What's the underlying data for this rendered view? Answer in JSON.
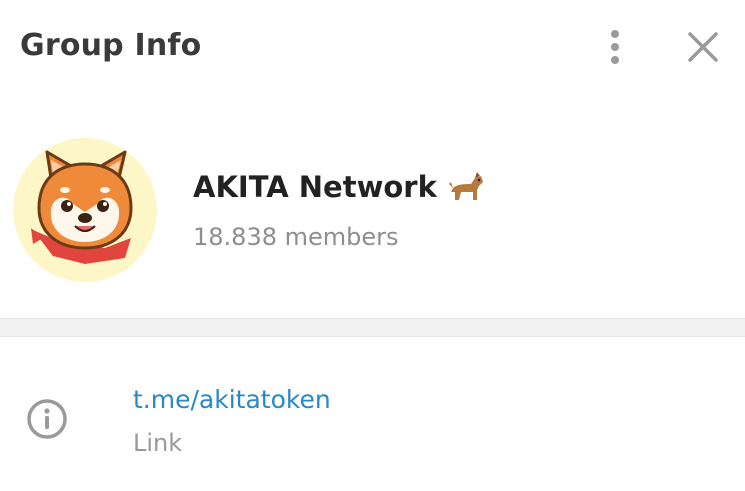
{
  "header": {
    "title": "Group Info",
    "menu_icon": "more-vertical-icon",
    "close_icon": "close-icon"
  },
  "group": {
    "name": "AKITA Network",
    "name_emoji": "dog-emoji",
    "members": "18.838 members",
    "avatar_icon": "shiba-dog-avatar"
  },
  "info": {
    "icon": "info-circle-icon",
    "link": "t.me/akitatoken",
    "link_label": "Link"
  },
  "colors": {
    "link": "#2a88c6",
    "secondary_text": "#8e8e8e",
    "icon_gray": "#9a9a9a",
    "avatar_bg": "#fdf6c6",
    "shiba_orange": "#ef8a3a",
    "bandana_red": "#e0463e"
  }
}
